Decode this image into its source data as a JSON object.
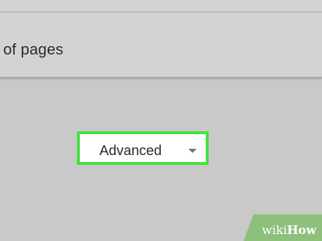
{
  "print_options": {
    "pages_option_label": "t of pages"
  },
  "advanced_dropdown": {
    "label": "Advanced",
    "icon": "chevron-down-icon"
  },
  "colors": {
    "highlight": "#40e23a",
    "background": "#c9c9c9",
    "panel": "#d3d3d3",
    "watermark": "#8dc07a"
  },
  "watermark": {
    "prefix": "wiki",
    "suffix": "How"
  }
}
